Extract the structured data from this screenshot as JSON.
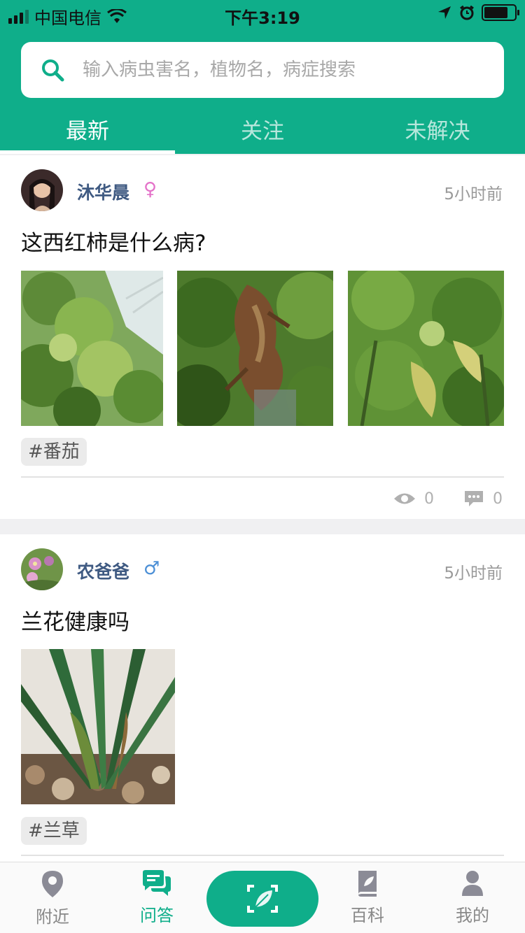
{
  "status": {
    "carrier": "中国电信",
    "time": "下午3:19"
  },
  "search": {
    "placeholder": "输入病虫害名，植物名，病症搜索"
  },
  "tabs": [
    {
      "label": "最新",
      "active": true
    },
    {
      "label": "关注"
    },
    {
      "label": "未解决"
    }
  ],
  "posts": [
    {
      "user": "沐华晨",
      "gender": "♀",
      "time": "5小时前",
      "title": "这西红柿是什么病?",
      "tag": "#番茄",
      "views": "0",
      "comments": "0"
    },
    {
      "user": "农爸爸",
      "gender": "♂",
      "time": "5小时前",
      "title": "兰花健康吗",
      "tag": "#兰草"
    }
  ],
  "tabbar": [
    {
      "label": "附近",
      "icon": "location-icon"
    },
    {
      "label": "问答",
      "icon": "chat-icon",
      "active": true
    },
    {
      "label": "",
      "icon": "scan-leaf-icon"
    },
    {
      "label": "百科",
      "icon": "book-icon"
    },
    {
      "label": "我的",
      "icon": "user-icon"
    }
  ],
  "colors": {
    "accent": "#0fae8a",
    "female": "#e472c9",
    "male": "#4b8fd6",
    "username": "#3f5a82"
  }
}
